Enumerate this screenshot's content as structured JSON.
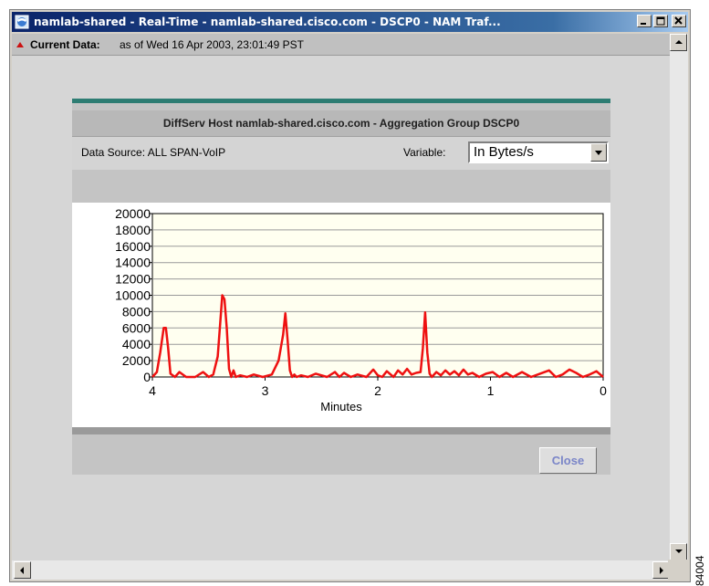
{
  "window": {
    "title": "namlab-shared - Real-Time - namlab-shared.cisco.com - DSCP0 - NAM Traf...",
    "controls": [
      "minimize",
      "maximize",
      "close"
    ]
  },
  "current_data": {
    "label": "Current Data:",
    "value": "as of Wed 16 Apr 2003, 23:01:49 PST"
  },
  "panel": {
    "title": "DiffServ Host namlab-shared.cisco.com - Aggregation Group DSCP0",
    "data_source": "Data Source: ALL SPAN-VoIP",
    "variable_label": "Variable:",
    "variable_value": "In Bytes/s",
    "close_label": "Close",
    "accent_color": "#2e7d73"
  },
  "chart_data": {
    "type": "line",
    "title": "",
    "xlabel": "Minutes",
    "ylabel": "",
    "ylim": [
      0,
      20000
    ],
    "xlim": [
      4,
      0
    ],
    "yticks": [
      "20000",
      "18000",
      "16000",
      "14000",
      "12000",
      "10000",
      "8000",
      "6000",
      "4000",
      "2000",
      "0"
    ],
    "xticks": [
      "4",
      "3",
      "2",
      "1",
      "0"
    ],
    "grid": true,
    "line_color": "#ee1111",
    "series": [
      {
        "x": [
          4.0,
          3.96,
          3.93,
          3.9,
          3.88,
          3.86,
          3.84,
          3.8,
          3.76,
          3.7,
          3.62,
          3.55,
          3.5,
          3.46,
          3.42,
          3.38,
          3.36,
          3.34,
          3.32,
          3.3,
          3.28,
          3.26,
          3.22,
          3.16,
          3.1,
          3.02,
          2.94,
          2.88,
          2.84,
          2.82,
          2.8,
          2.78,
          2.76,
          2.74,
          2.72,
          2.68,
          2.62,
          2.55,
          2.45,
          2.38,
          2.34,
          2.3,
          2.24,
          2.18,
          2.1,
          2.04,
          2.0,
          1.96,
          1.92,
          1.86,
          1.82,
          1.78,
          1.74,
          1.7,
          1.66,
          1.62,
          1.6,
          1.58,
          1.56,
          1.54,
          1.52,
          1.48,
          1.44,
          1.4,
          1.36,
          1.32,
          1.28,
          1.24,
          1.2,
          1.16,
          1.1,
          1.04,
          0.98,
          0.92,
          0.86,
          0.8,
          0.72,
          0.64,
          0.56,
          0.48,
          0.42,
          0.36,
          0.3,
          0.24,
          0.18,
          0.12,
          0.06,
          0.0
        ],
        "y": [
          0,
          600,
          3000,
          6000,
          6000,
          3500,
          400,
          0,
          600,
          0,
          0,
          600,
          0,
          300,
          2500,
          10000,
          9500,
          6000,
          1000,
          0,
          800,
          0,
          200,
          0,
          300,
          0,
          300,
          2000,
          5200,
          7800,
          4500,
          800,
          0,
          300,
          0,
          200,
          0,
          400,
          0,
          600,
          0,
          500,
          0,
          300,
          0,
          900,
          200,
          0,
          700,
          0,
          800,
          300,
          1000,
          300,
          500,
          600,
          3500,
          7900,
          3000,
          400,
          0,
          600,
          200,
          800,
          300,
          700,
          200,
          900,
          300,
          500,
          0,
          400,
          600,
          0,
          500,
          0,
          600,
          0,
          400,
          800,
          0,
          300,
          900,
          500,
          0,
          300,
          700,
          0
        ]
      }
    ]
  }
}
